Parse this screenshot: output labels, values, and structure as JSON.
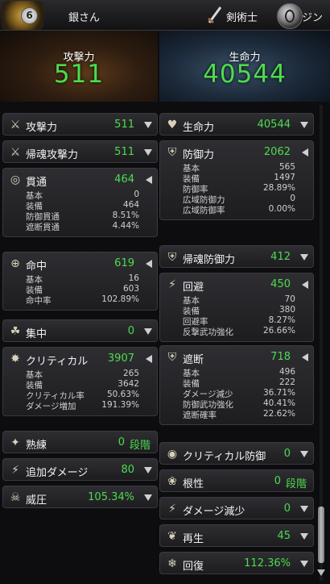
{
  "topbar": {
    "level": "6",
    "player_name": "銀さん",
    "class_name": "剣術士",
    "server": "ジン"
  },
  "hero": {
    "attack": {
      "label": "攻撃力",
      "value": "511"
    },
    "hp": {
      "label": "生命力",
      "value": "40544"
    }
  },
  "left": [
    {
      "icon": "crossed-swords-icon",
      "glyph": "⚔",
      "label": "攻撃力",
      "value": "511",
      "arrow": "down",
      "subs": []
    },
    {
      "icon": "soul-sword-icon",
      "glyph": "⚔",
      "label": "帰魂攻撃力",
      "value": "511",
      "arrow": "down",
      "subs": []
    },
    {
      "icon": "pierce-icon",
      "glyph": "◎",
      "label": "貫通",
      "value": "464",
      "arrow": "left",
      "subs": [
        {
          "l": "基本",
          "v": "0"
        },
        {
          "l": "装備",
          "v": "464"
        },
        {
          "l": "防御貫通",
          "v": "8.51%"
        },
        {
          "l": "遮断貫通",
          "v": "4.44%"
        }
      ]
    },
    {
      "icon": "crosshair-icon",
      "glyph": "⊕",
      "label": "命中",
      "value": "619",
      "arrow": "left",
      "subs": [
        {
          "l": "基本",
          "v": "16"
        },
        {
          "l": "装備",
          "v": "603"
        },
        {
          "l": "命中率",
          "v": "102.89%"
        }
      ]
    },
    {
      "icon": "focus-icon",
      "glyph": "☘",
      "label": "集中",
      "value": "0",
      "arrow": "down",
      "subs": []
    },
    {
      "icon": "critical-icon",
      "glyph": "✸",
      "label": "クリティカル",
      "value": "3907",
      "arrow": "left",
      "subs": [
        {
          "l": "基本",
          "v": "265"
        },
        {
          "l": "装備",
          "v": "3642"
        },
        {
          "l": "クリティカル率",
          "v": "50.63%"
        },
        {
          "l": "ダメージ増加",
          "v": "191.39%"
        }
      ]
    },
    {
      "icon": "mastery-icon",
      "glyph": "✦",
      "label": "熟練",
      "value": "0",
      "unit": "段階",
      "arrow": "none",
      "subs": []
    },
    {
      "icon": "extra-damage-icon",
      "glyph": "⚡",
      "label": "追加ダメージ",
      "value": "80",
      "arrow": "down",
      "subs": []
    },
    {
      "icon": "intimidate-icon",
      "glyph": "☠",
      "label": "威圧",
      "value": "105.34%",
      "arrow": "down",
      "subs": []
    }
  ],
  "right": [
    {
      "icon": "heart-icon",
      "glyph": "♥",
      "label": "生命力",
      "value": "40544",
      "arrow": "down",
      "subs": []
    },
    {
      "icon": "shield-icon",
      "glyph": "⛨",
      "label": "防御力",
      "value": "2062",
      "arrow": "left",
      "subs": [
        {
          "l": "基本",
          "v": "565"
        },
        {
          "l": "装備",
          "v": "1497"
        },
        {
          "l": "防御率",
          "v": "28.89%"
        },
        {
          "l": "広域防御力",
          "v": "0"
        },
        {
          "l": "広域防御率",
          "v": "0.00%"
        }
      ]
    },
    {
      "icon": "soul-shield-icon",
      "glyph": "⛨",
      "label": "帰魂防御力",
      "value": "412",
      "arrow": "down",
      "subs": []
    },
    {
      "icon": "evade-icon",
      "glyph": "⚡",
      "label": "回避",
      "value": "450",
      "arrow": "left",
      "subs": [
        {
          "l": "基本",
          "v": "70"
        },
        {
          "l": "装備",
          "v": "380"
        },
        {
          "l": "回避率",
          "v": "8.27%"
        },
        {
          "l": "反撃武功強化",
          "v": "26.66%"
        }
      ]
    },
    {
      "icon": "block-icon",
      "glyph": "⛨",
      "label": "遮断",
      "value": "718",
      "arrow": "left",
      "subs": [
        {
          "l": "基本",
          "v": "496"
        },
        {
          "l": "装備",
          "v": "222"
        },
        {
          "l": "ダメージ減少",
          "v": "36.71%"
        },
        {
          "l": "防御武功強化",
          "v": "40.41%"
        },
        {
          "l": "遮断確率",
          "v": "22.62%"
        }
      ]
    },
    {
      "icon": "critical-defense-icon",
      "glyph": "◉",
      "label": "クリティカル防御",
      "value": "0",
      "arrow": "down",
      "subs": []
    },
    {
      "icon": "tenacity-icon",
      "glyph": "❀",
      "label": "根性",
      "value": "0",
      "unit": "段階",
      "arrow": "none",
      "subs": []
    },
    {
      "icon": "damage-reduce-icon",
      "glyph": "⚡",
      "label": "ダメージ減少",
      "value": "0",
      "arrow": "down",
      "subs": []
    },
    {
      "icon": "regen-icon",
      "glyph": "❦",
      "label": "再生",
      "value": "45",
      "arrow": "down",
      "subs": []
    },
    {
      "icon": "recovery-icon",
      "glyph": "❄",
      "label": "回復",
      "value": "112.36%",
      "arrow": "down",
      "subs": []
    }
  ]
}
